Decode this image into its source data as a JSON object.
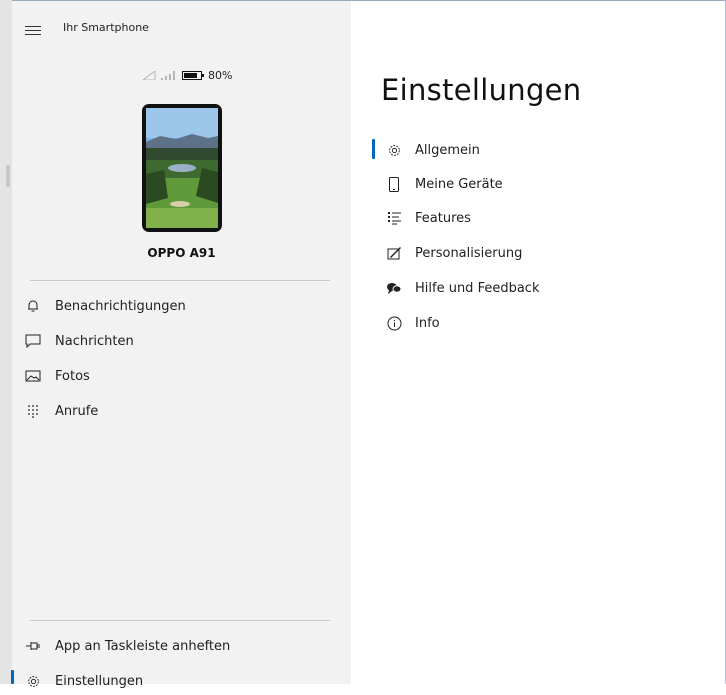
{
  "app": {
    "title": "Ihr Smartphone"
  },
  "device": {
    "battery": "80%",
    "battery_level": 0.8,
    "name": "OPPO A91"
  },
  "sidebar": {
    "items": [
      {
        "label": "Benachrichtigungen",
        "icon": "bell-icon"
      },
      {
        "label": "Nachrichten",
        "icon": "message-icon"
      },
      {
        "label": "Fotos",
        "icon": "photos-icon"
      },
      {
        "label": "Anrufe",
        "icon": "dialpad-icon"
      }
    ],
    "bottom": [
      {
        "label": "App an Taskleiste anheften",
        "icon": "pin-icon"
      },
      {
        "label": "Einstellungen",
        "icon": "gear-icon",
        "active": true
      }
    ]
  },
  "main": {
    "title": "Einstellungen",
    "items": [
      {
        "label": "Allgemein",
        "icon": "gear-icon",
        "active": true
      },
      {
        "label": "Meine Geräte",
        "icon": "phone-icon"
      },
      {
        "label": "Features",
        "icon": "features-list-icon"
      },
      {
        "label": "Personalisierung",
        "icon": "personalize-icon"
      },
      {
        "label": "Hilfe und Feedback",
        "icon": "help-feedback-icon"
      },
      {
        "label": "Info",
        "icon": "info-icon"
      }
    ]
  },
  "colors": {
    "accent": "#0067c0",
    "sidebar_bg": "#f2f2f2",
    "main_bg": "#ffffff"
  }
}
